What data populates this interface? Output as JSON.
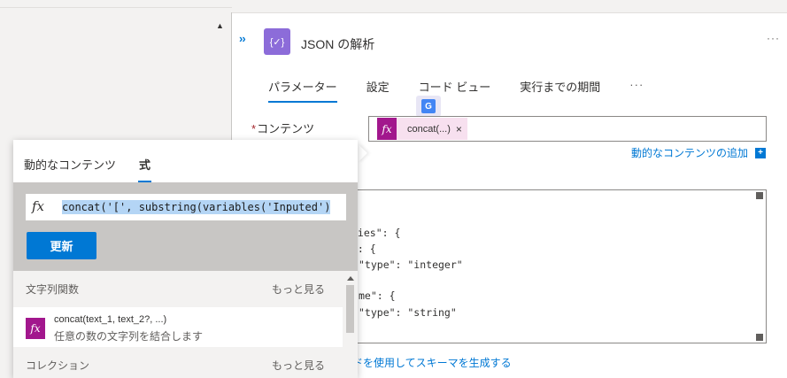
{
  "action": {
    "title": "JSON の解析",
    "icon": "braces-icon",
    "color": "#8c6cd9"
  },
  "tabs": [
    "パラメーター",
    "設定",
    "コード ビュー",
    "実行までの期間"
  ],
  "content_field": {
    "label": "コンテンツ",
    "required_mark": "*",
    "token_label": "concat(...)",
    "token_close": "×"
  },
  "dynamic_add": "動的なコンテンツの追加",
  "schema_lines": [
    {
      "pre": "ties\": {",
      "key": ""
    },
    {
      "pre": "\": {",
      "key": ""
    },
    {
      "pre": "\"type\": \"integer\"",
      "key": ""
    },
    {
      "pre": "me\": {",
      "key": ""
    },
    {
      "pre": "\"type\": \"string\"",
      "key": ""
    }
  ],
  "sample_link": "ドを使用してスキーマを生成する",
  "popup": {
    "tabs": [
      "動的なコンテンツ",
      "式"
    ],
    "expression": "concat('[', substring(variables('Inputed')",
    "update_label": "更新",
    "sections": [
      {
        "title": "文字列関数",
        "more": "もっと見る"
      },
      {
        "title": "コレクション",
        "more": "もっと見る"
      }
    ],
    "function_item": {
      "name": "concat(text_1, text_2?, ...)",
      "description": "任意の数の文字列を結合します"
    }
  },
  "colors": {
    "accent": "#0078d4",
    "expression_token": "#a2178d"
  }
}
